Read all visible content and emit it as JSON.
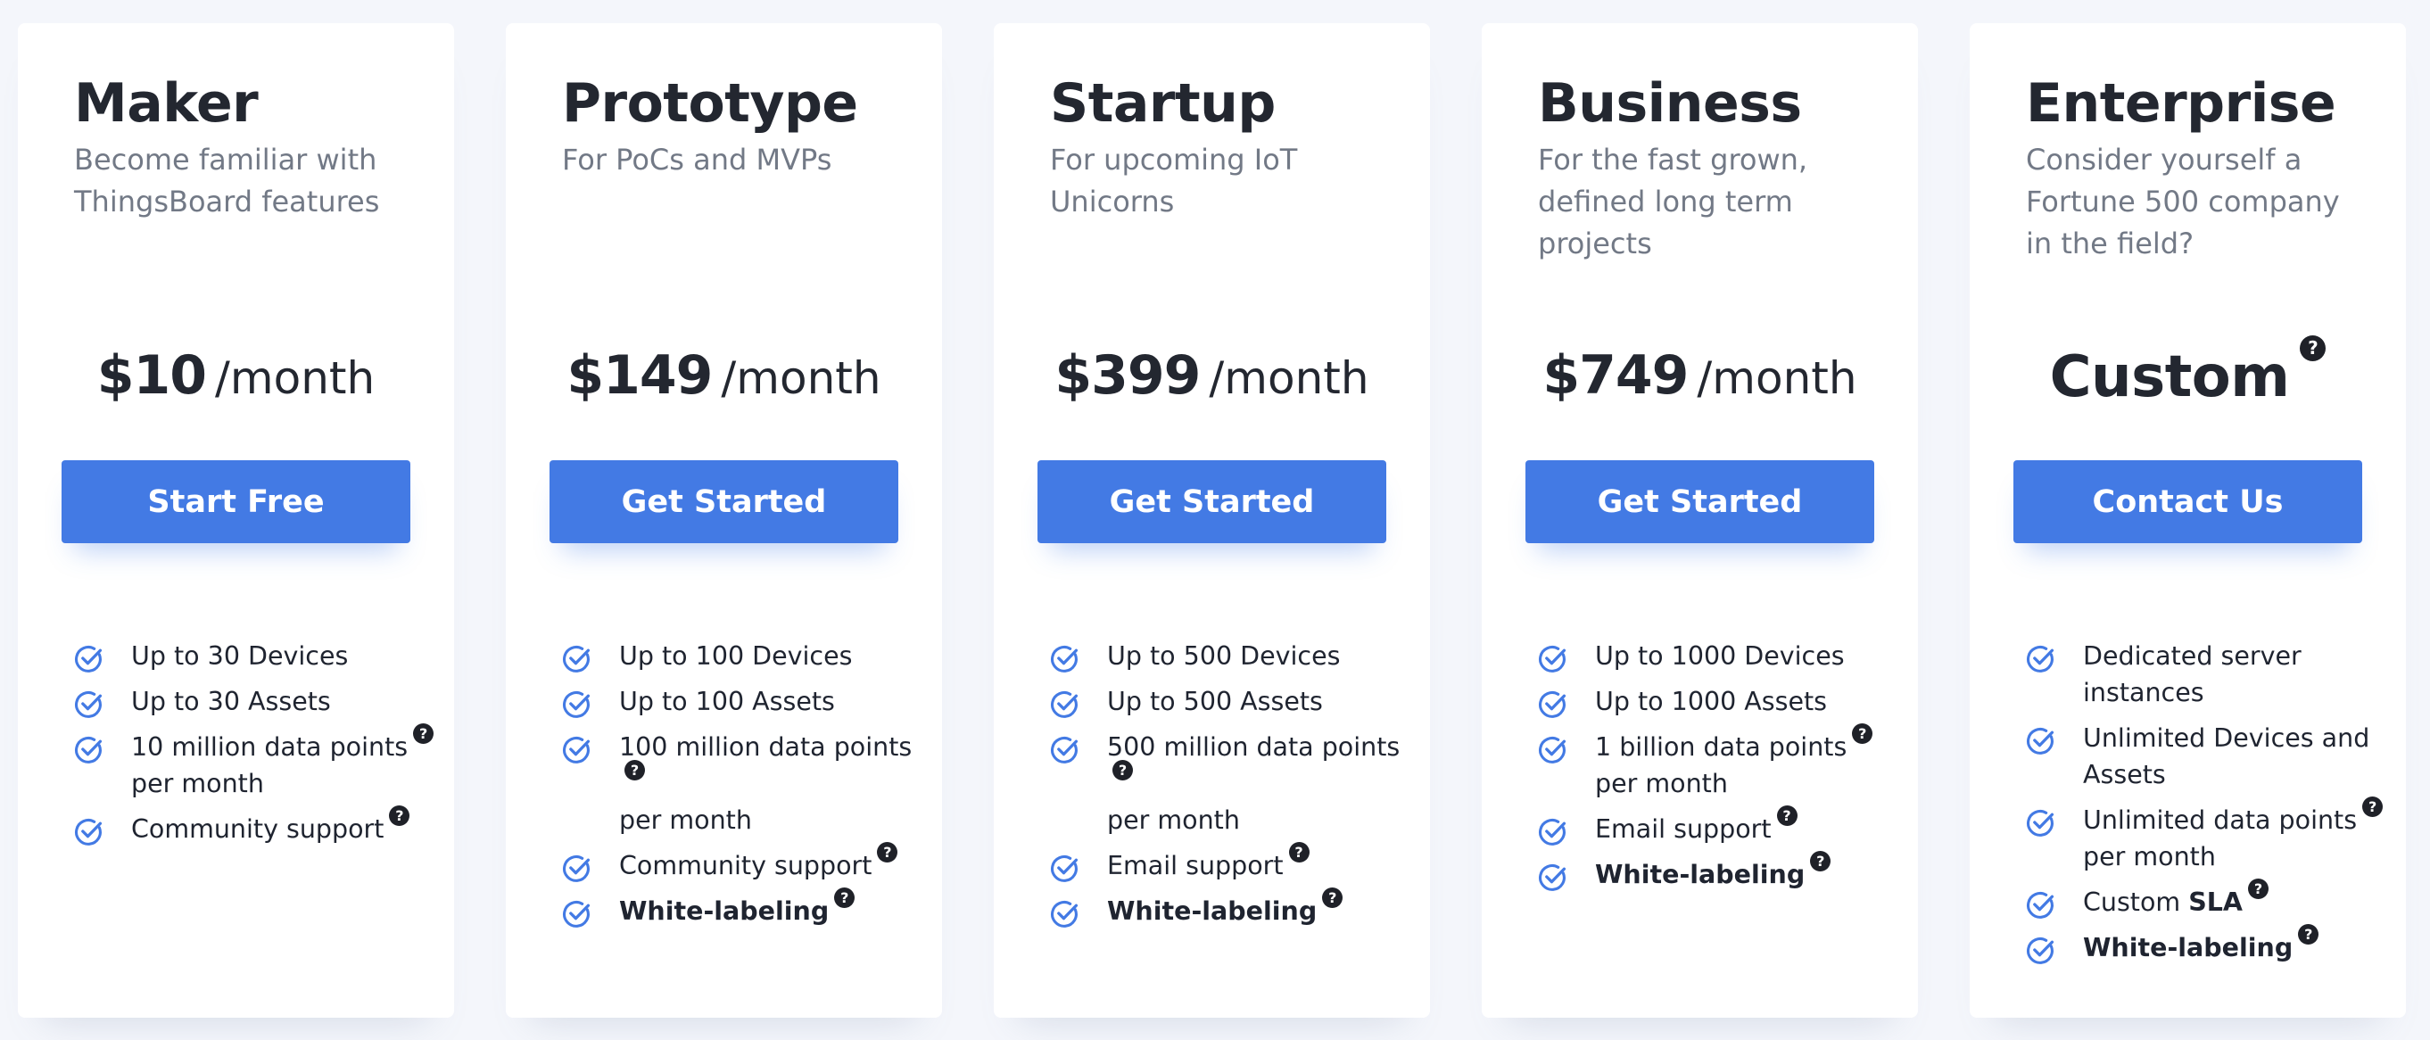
{
  "colors": {
    "accent": "#437ae4",
    "page_background": "#f4f6fb",
    "card_background": "#ffffff",
    "heading": "#232730",
    "muted_text": "#727986",
    "check_icon": "#437ae4",
    "help_icon": "#1f2128"
  },
  "icons": {
    "feature_check": "check-circle-icon",
    "help": "question-circle-icon"
  },
  "plans": [
    {
      "name": "Maker",
      "description": "Become familiar with ThingsBoard features",
      "price": "$10",
      "period": "/month",
      "cta": "Start Free",
      "features": [
        {
          "text": "Up to 30 Devices"
        },
        {
          "text": "Up to 30 Assets"
        },
        {
          "text": "10 million data points",
          "text2": "per month"
        },
        {
          "text": "Community support"
        }
      ]
    },
    {
      "name": "Prototype",
      "description": "For PoCs and MVPs",
      "price": "$149",
      "period": "/month",
      "cta": "Get Started",
      "features": [
        {
          "text": "Up to 100 Devices"
        },
        {
          "text": "Up to 100 Assets"
        },
        {
          "text": "100 million data points",
          "text2": "per month"
        },
        {
          "text": "Community support"
        },
        {
          "text": "White-labeling"
        }
      ]
    },
    {
      "name": "Startup",
      "description": "For upcoming IoT Unicorns",
      "price": "$399",
      "period": "/month",
      "cta": "Get Started",
      "features": [
        {
          "text": "Up to 500 Devices"
        },
        {
          "text": "Up to 500 Assets"
        },
        {
          "text": "500 million data points",
          "text2": "per month"
        },
        {
          "text": "Email support"
        },
        {
          "text": "White-labeling"
        }
      ]
    },
    {
      "name": "Business",
      "description": "For the fast grown, defined long term projects",
      "price": "$749",
      "period": "/month",
      "cta": "Get Started",
      "features": [
        {
          "text": "Up to 1000 Devices"
        },
        {
          "text": "Up to 1000 Assets"
        },
        {
          "text": "1 billion data points",
          "text2": "per month"
        },
        {
          "text": "Email support"
        },
        {
          "text": "White-labeling"
        }
      ]
    },
    {
      "name": "Enterprise",
      "description": "Consider yourself a Fortune 500 company in the field?",
      "price": "Custom",
      "cta": "Contact Us",
      "features": [
        {
          "text": "Dedicated server instances"
        },
        {
          "text": "Unlimited Devices and Assets"
        },
        {
          "text": "Unlimited data points",
          "text2": "per month"
        },
        {
          "text": "Custom",
          "bold": "SLA"
        },
        {
          "text": "White-labeling"
        }
      ]
    }
  ]
}
